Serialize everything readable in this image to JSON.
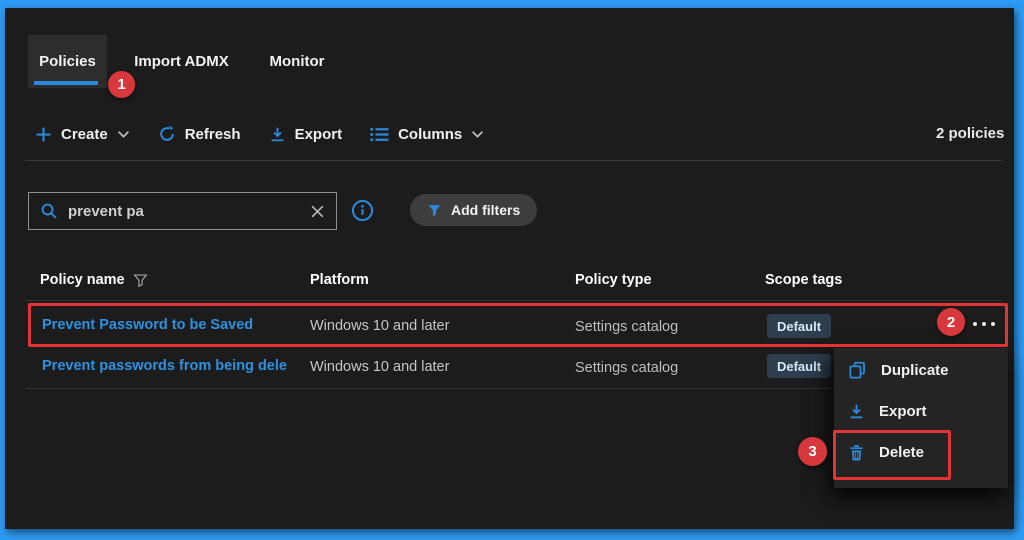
{
  "tabs": {
    "policies": "Policies",
    "import_admx": "Import ADMX",
    "monitor": "Monitor"
  },
  "toolbar": {
    "create": "Create",
    "refresh": "Refresh",
    "export": "Export",
    "columns": "Columns",
    "count": "2 policies"
  },
  "search": {
    "value": "prevent pa",
    "add_filters": "Add filters"
  },
  "table": {
    "headers": {
      "name": "Policy name",
      "platform": "Platform",
      "type": "Policy type",
      "scope": "Scope tags"
    },
    "rows": [
      {
        "name": "Prevent Password to be Saved",
        "platform": "Windows 10 and later",
        "type": "Settings catalog",
        "scope_tag": "Default"
      },
      {
        "name": "Prevent passwords from being dele",
        "platform": "Windows 10 and later",
        "type": "Settings catalog",
        "scope_tag": "Default"
      }
    ]
  },
  "context_menu": {
    "duplicate": "Duplicate",
    "export": "Export",
    "delete": "Delete"
  },
  "annotations": {
    "step_1": "1",
    "step_2": "2",
    "step_3": "3"
  },
  "colors": {
    "accent_blue": "#2b88d8",
    "frame_blue": "#2f9bf4",
    "annotation_red": "#d8383c",
    "link_blue": "#2e90e0",
    "badge_bg": "#2e3e4e"
  }
}
